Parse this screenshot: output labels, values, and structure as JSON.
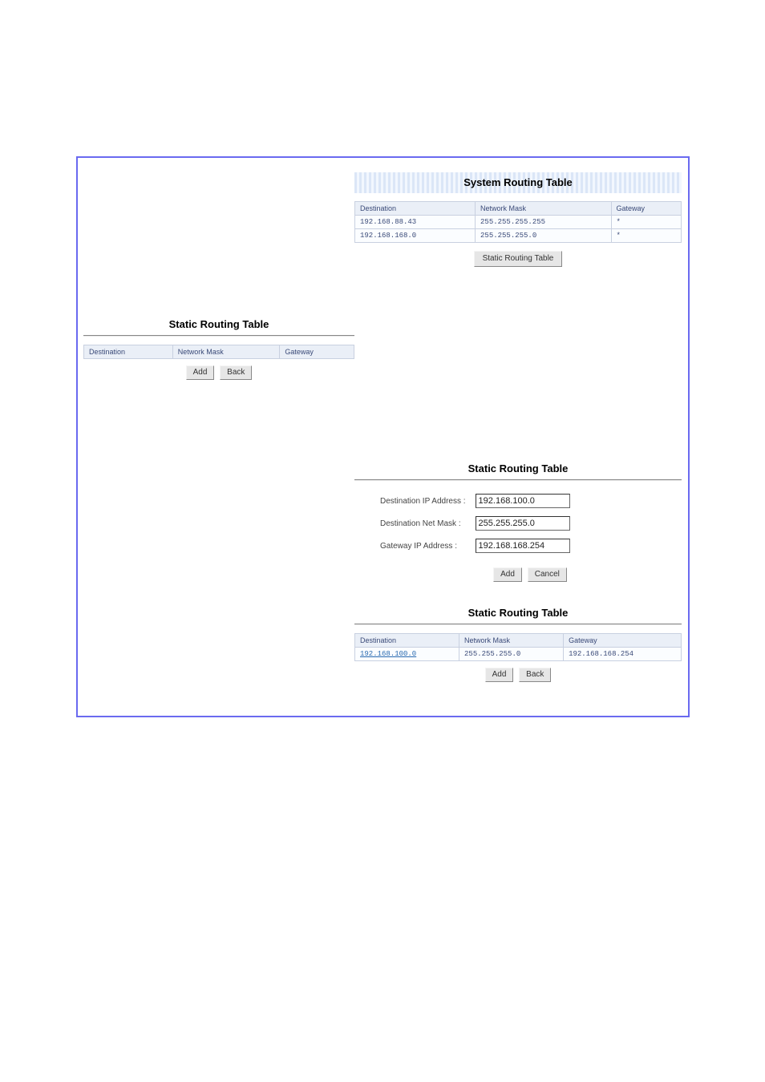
{
  "system": {
    "title": "System Routing Table",
    "columns": {
      "destination": "Destination",
      "mask": "Network Mask",
      "gateway": "Gateway"
    },
    "rows": [
      {
        "destination": "192.168.88.43",
        "mask": "255.255.255.255",
        "gateway": "*"
      },
      {
        "destination": "192.168.168.0",
        "mask": "255.255.255.0",
        "gateway": "*"
      }
    ],
    "button": "Static Routing Table"
  },
  "static_empty": {
    "title": "Static Routing Table",
    "columns": {
      "destination": "Destination",
      "mask": "Network Mask",
      "gateway": "Gateway"
    },
    "buttons": {
      "add": "Add",
      "back": "Back"
    }
  },
  "form": {
    "title": "Static Routing Table",
    "labels": {
      "destination": "Destination IP Address :",
      "mask": "Destination Net Mask :",
      "gateway": "Gateway IP Address :"
    },
    "values": {
      "destination": "192.168.100.0",
      "mask": "255.255.255.0",
      "gateway": "192.168.168.254"
    },
    "buttons": {
      "add": "Add",
      "cancel": "Cancel"
    }
  },
  "result": {
    "title": "Static Routing Table",
    "columns": {
      "destination": "Destination",
      "mask": "Network Mask",
      "gateway": "Gateway"
    },
    "rows": [
      {
        "destination": "192.168.100.0",
        "mask": "255.255.255.0",
        "gateway": "192.168.168.254"
      }
    ],
    "buttons": {
      "add": "Add",
      "back": "Back"
    }
  }
}
